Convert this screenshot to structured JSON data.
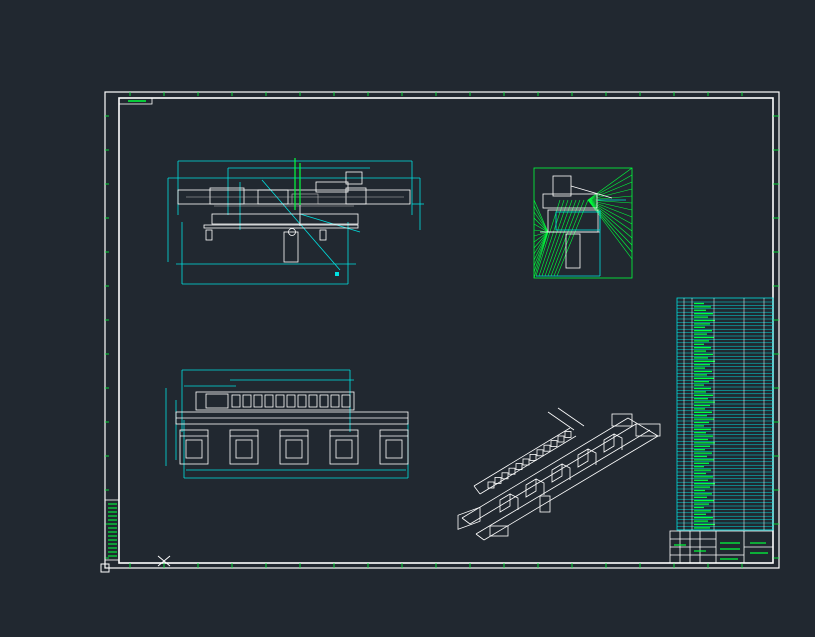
{
  "app": {
    "view": "model-space"
  },
  "colors": {
    "background": "#212830",
    "frame": "#ffffff",
    "dim": "#00e0e0",
    "green": "#00ff3c",
    "part": "#ffffff",
    "hidden": "#bcbcbc"
  },
  "icons": {
    "cursor": "crosshair-icon",
    "ucs": "ucs-origin-icon"
  }
}
